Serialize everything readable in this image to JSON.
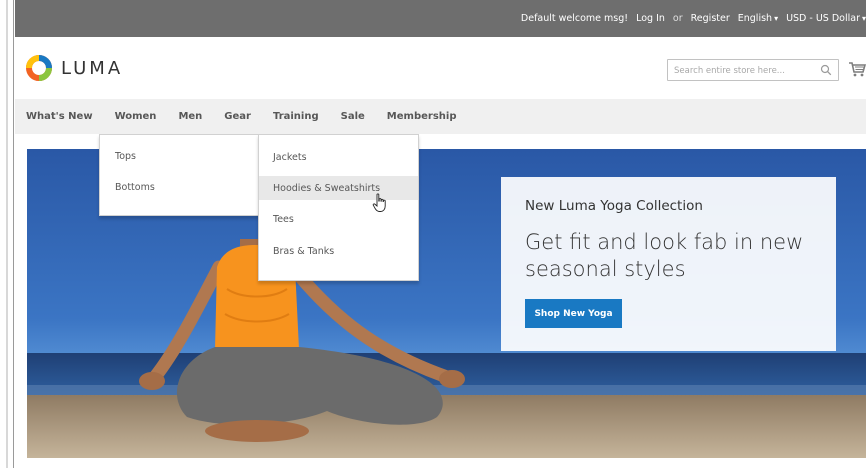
{
  "panel": {
    "welcome": "Default welcome msg!",
    "login": "Log In",
    "or": "or",
    "register": "Register",
    "language": "English",
    "currency": "USD - US Dollar"
  },
  "header": {
    "logo_text": "LUMA",
    "search_placeholder": "Search entire store here..."
  },
  "nav": {
    "items": [
      "What's New",
      "Women",
      "Men",
      "Gear",
      "Training",
      "Sale",
      "Membership"
    ]
  },
  "menus": {
    "women": [
      "Tops",
      "Bottoms"
    ],
    "training": [
      "Jackets",
      "Hoodies & Sweatshirts",
      "Tees",
      "Bras & Tanks"
    ],
    "hovered_item": "Hoodies & Sweatshirts"
  },
  "hero": {
    "kicker": "New Luma Yoga Collection",
    "headline": "Get fit and look fab in new seasonal styles",
    "cta": "Shop New Yoga"
  },
  "colors": {
    "panel_bg": "#6e6e6e",
    "nav_bg": "#f0f0f0",
    "button_blue": "#1979c3",
    "logo_orange": "#f26322",
    "sky_blue": "#2f5fa8",
    "shirt_orange": "#f7931e"
  }
}
